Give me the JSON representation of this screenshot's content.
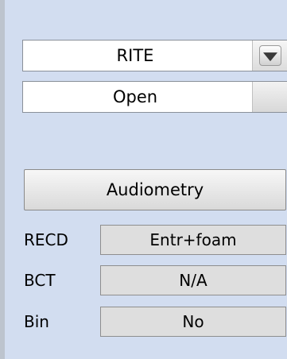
{
  "style_dropdown": {
    "value": "RITE",
    "icon": "dropdown-arrow-icon"
  },
  "venting_dropdown": {
    "value": "Open"
  },
  "audiometry_button": {
    "label": "Audiometry"
  },
  "rows": [
    {
      "label": "RECD",
      "value": "Entr+foam"
    },
    {
      "label": "BCT",
      "value": "N/A"
    },
    {
      "label": "Bin",
      "value": "No"
    }
  ],
  "colors": {
    "panel_background": "#d2ddf0",
    "field_background": "#dedede"
  }
}
